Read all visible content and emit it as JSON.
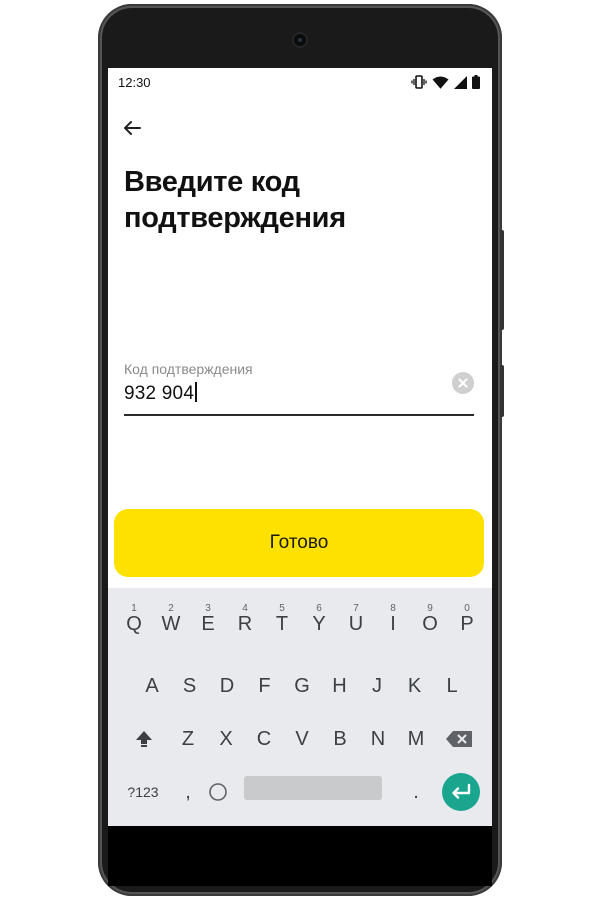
{
  "status_bar": {
    "time": "12:30"
  },
  "header": {
    "title_line1": "Введите код",
    "title_line2": "подтверждения"
  },
  "code_field": {
    "label": "Код подтверждения",
    "value": "932 904"
  },
  "done_button": {
    "label": "Готово"
  },
  "keyboard": {
    "row1": [
      {
        "k": "Q",
        "h": "1"
      },
      {
        "k": "W",
        "h": "2"
      },
      {
        "k": "E",
        "h": "3"
      },
      {
        "k": "R",
        "h": "4"
      },
      {
        "k": "T",
        "h": "5"
      },
      {
        "k": "Y",
        "h": "6"
      },
      {
        "k": "U",
        "h": "7"
      },
      {
        "k": "I",
        "h": "8"
      },
      {
        "k": "O",
        "h": "9"
      },
      {
        "k": "P",
        "h": "0"
      }
    ],
    "row2": [
      "A",
      "S",
      "D",
      "F",
      "G",
      "H",
      "J",
      "K",
      "L"
    ],
    "row3": [
      "Z",
      "X",
      "C",
      "V",
      "B",
      "N",
      "M"
    ],
    "symbols_label": "?123",
    "comma": ",",
    "period": "."
  },
  "colors": {
    "accent_yellow": "#ffe100",
    "enter_teal": "#1aa58f",
    "keyboard_bg": "#e8eaed"
  },
  "icons": {
    "back": "arrow-left-icon",
    "clear": "clear-circle-icon",
    "shift": "shift-icon",
    "backspace": "backspace-icon",
    "emoji": "emoji-circle-icon",
    "enter": "enter-return-icon"
  }
}
